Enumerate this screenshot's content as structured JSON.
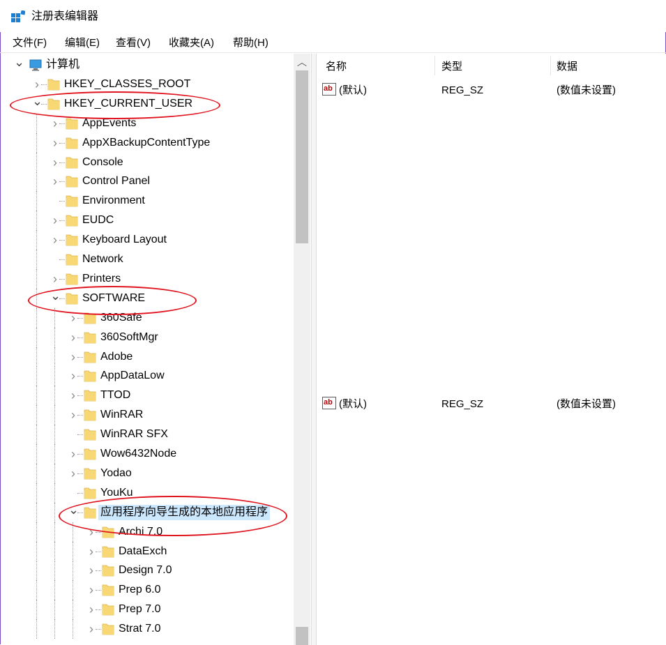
{
  "window": {
    "title": "注册表编辑器",
    "icon": "regedit-icon"
  },
  "menu": [
    "文件(F)",
    "编辑(E)",
    "查看(V)",
    "收藏夹(A)",
    "帮助(H)"
  ],
  "tree": [
    {
      "label": "计算机",
      "level": 0,
      "arrow": "expanded",
      "icon": "computer-icon"
    },
    {
      "label": "HKEY_CLASSES_ROOT",
      "level": 1,
      "arrow": "collapsed"
    },
    {
      "label": "HKEY_CURRENT_USER",
      "level": 1,
      "arrow": "expanded"
    },
    {
      "label": "AppEvents",
      "level": 2,
      "arrow": "collapsed"
    },
    {
      "label": "AppXBackupContentType",
      "level": 2,
      "arrow": "collapsed"
    },
    {
      "label": "Console",
      "level": 2,
      "arrow": "collapsed"
    },
    {
      "label": "Control Panel",
      "level": 2,
      "arrow": "collapsed"
    },
    {
      "label": "Environment",
      "level": 2,
      "arrow": "none"
    },
    {
      "label": "EUDC",
      "level": 2,
      "arrow": "collapsed"
    },
    {
      "label": "Keyboard Layout",
      "level": 2,
      "arrow": "collapsed"
    },
    {
      "label": "Network",
      "level": 2,
      "arrow": "none"
    },
    {
      "label": "Printers",
      "level": 2,
      "arrow": "collapsed"
    },
    {
      "label": "SOFTWARE",
      "level": 2,
      "arrow": "expanded"
    },
    {
      "label": "360Safe",
      "level": 3,
      "arrow": "collapsed"
    },
    {
      "label": "360SoftMgr",
      "level": 3,
      "arrow": "collapsed"
    },
    {
      "label": "Adobe",
      "level": 3,
      "arrow": "collapsed"
    },
    {
      "label": "AppDataLow",
      "level": 3,
      "arrow": "collapsed"
    },
    {
      "label": "TTOD",
      "level": 3,
      "arrow": "collapsed"
    },
    {
      "label": "WinRAR",
      "level": 3,
      "arrow": "collapsed"
    },
    {
      "label": "WinRAR SFX",
      "level": 3,
      "arrow": "none"
    },
    {
      "label": "Wow6432Node",
      "level": 3,
      "arrow": "collapsed"
    },
    {
      "label": "Yodao",
      "level": 3,
      "arrow": "collapsed"
    },
    {
      "label": "YouKu",
      "level": 3,
      "arrow": "none"
    },
    {
      "label": "应用程序向导生成的本地应用程序",
      "level": 3,
      "arrow": "expanded",
      "selected": true
    },
    {
      "label": "Archi 7.0",
      "level": 4,
      "arrow": "collapsed"
    },
    {
      "label": "DataExch",
      "level": 4,
      "arrow": "collapsed"
    },
    {
      "label": "Design 7.0",
      "level": 4,
      "arrow": "collapsed"
    },
    {
      "label": "Prep 6.0",
      "level": 4,
      "arrow": "collapsed"
    },
    {
      "label": "Prep 7.0",
      "level": 4,
      "arrow": "collapsed"
    },
    {
      "label": "Strat 7.0",
      "level": 4,
      "arrow": "collapsed"
    }
  ],
  "highlighted_keys": [
    "HKEY_CURRENT_USER",
    "SOFTWARE",
    "应用程序向导生成的本地应用程序"
  ],
  "values": {
    "columns": {
      "name": "名称",
      "type": "类型",
      "data": "数据"
    },
    "rows": [
      {
        "name": "(默认)",
        "type": "REG_SZ",
        "data": "(数值未设置)",
        "icon": "string-value-icon"
      },
      {
        "name": "(默认)",
        "type": "REG_SZ",
        "data": "(数值未设置)",
        "icon": "string-value-icon"
      }
    ]
  },
  "colors": {
    "selection": "#cce8ff",
    "annotation": "#e0141e",
    "folder": "#f8d775",
    "window_border": "#7a4fc0"
  }
}
